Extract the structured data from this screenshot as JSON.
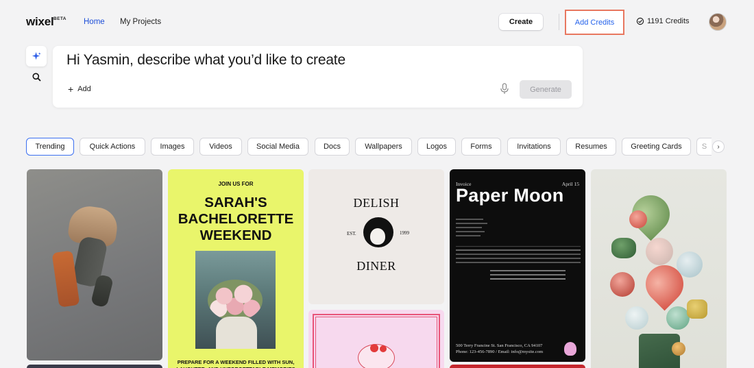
{
  "app": {
    "logo": "wixel",
    "logo_badge": "BETA"
  },
  "nav": {
    "home": "Home",
    "my_projects": "My Projects",
    "create": "Create",
    "add_credits": "Add Credits",
    "credits": "1191 Credits"
  },
  "prompt": {
    "heading": "Hi Yasmin, describe what you’d like to create",
    "add_label": "Add",
    "generate_label": "Generate"
  },
  "categories": [
    "Trending",
    "Quick Actions",
    "Images",
    "Videos",
    "Social Media",
    "Docs",
    "Wallpapers",
    "Logos",
    "Forms",
    "Invitations",
    "Resumes",
    "Greeting Cards",
    "S"
  ],
  "active_category": "Trending",
  "cards": {
    "bachelorette": {
      "kicker": "JOIN US FOR",
      "headline_1": "SARAH'S",
      "headline_2": "BACHELORETTE",
      "headline_3": "WEEKEND",
      "footer": "PREPARE FOR A WEEKEND FILLED WITH SUN, LAUGHTER, AND UNFORGETTABLE MEMORIES"
    },
    "diner": {
      "top": "DELISH",
      "bottom": "DINER",
      "est": "EST.",
      "year": "1999"
    },
    "invoice": {
      "label": "Invoice",
      "date": "April 15",
      "title": "Paper Moon",
      "address": "500 Terry Francine St. San Francisco, CA 94107",
      "contact": "Phone: 123-456-7890 / Email: info@mysite.com"
    }
  },
  "colors": {
    "accent": "#2563eb",
    "highlight_border": "#e8775f",
    "bachelorette_bg": "#e9f56b",
    "invoice_bg": "#0d0d0d"
  }
}
